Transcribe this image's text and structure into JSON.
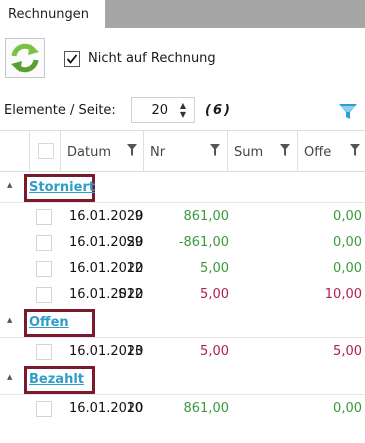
{
  "tab": {
    "label": "Rechnungen"
  },
  "toolbar": {
    "refresh_icon": "refresh-arrows-icon",
    "checkbox_label": "Nicht auf Rechnung",
    "checkbox_checked": true
  },
  "pager": {
    "label": "Elemente / Seite:",
    "page_size": "20",
    "count": "(6)"
  },
  "colors": {
    "group_text": "#2e9dc8",
    "highlight_border": "#7a1a2c",
    "positive": "#3b9a3b",
    "negative": "#b0204a",
    "filter_icon": "#2a9fd6"
  },
  "grid": {
    "columns": [
      {
        "label": "Datum"
      },
      {
        "label": "Nr"
      },
      {
        "label": "Sum"
      },
      {
        "label": "Offe"
      }
    ],
    "groups": [
      {
        "name": "Storniert",
        "rows": [
          {
            "date": "16.01.2020",
            "nr": "9",
            "sum": "861,00",
            "open": "0,00"
          },
          {
            "date": "16.01.2020",
            "nr": "S9",
            "sum": "-861,00",
            "open": "0,00"
          },
          {
            "date": "16.01.2020",
            "nr": "12",
            "sum": "5,00",
            "open": "0,00"
          },
          {
            "date": "16.01.2020",
            "nr": "S12",
            "sum": "5,00",
            "open": "10,00"
          }
        ]
      },
      {
        "name": "Offen",
        "rows": [
          {
            "date": "16.01.2020",
            "nr": "13",
            "sum": "5,00",
            "open": "5,00"
          }
        ]
      },
      {
        "name": "Bezahlt",
        "rows": [
          {
            "date": "16.01.2020",
            "nr": "10",
            "sum": "861,00",
            "open": "0,00"
          }
        ]
      }
    ]
  }
}
